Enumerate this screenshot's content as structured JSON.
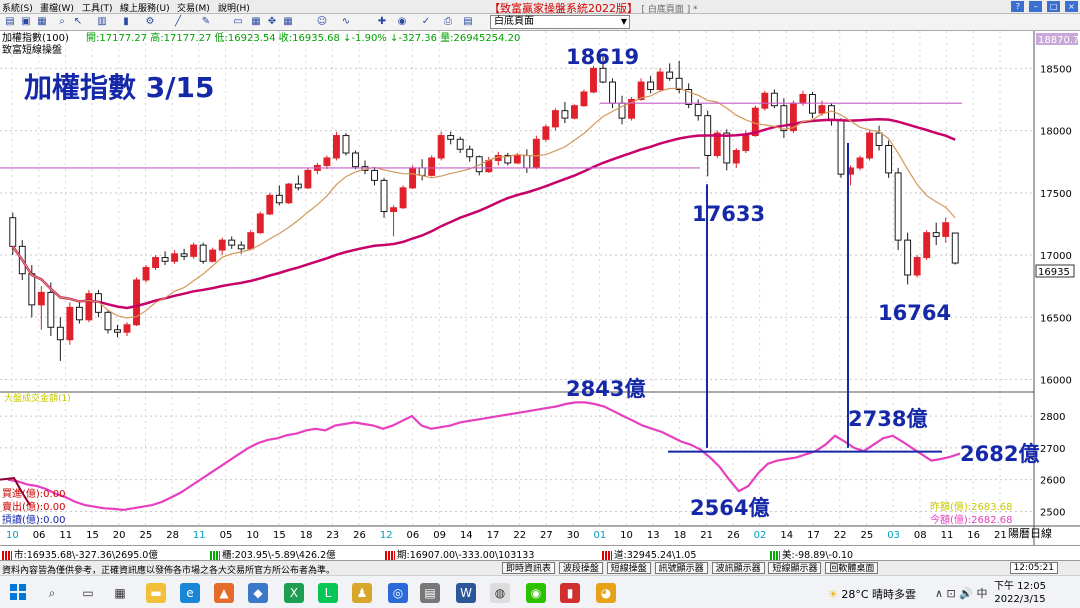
{
  "menu": {
    "items": [
      "系統(S)",
      "畫檔(W)",
      "工具(T)",
      "線上服務(U)",
      "交易(M)",
      "說明(H)"
    ],
    "title": "【致富贏家操盤系統2022版】",
    "title_sub": "[ 白底頁面 ] *",
    "window_buttons": [
      "?",
      "–",
      "□",
      "×"
    ]
  },
  "toolbar": {
    "page_select": "白底頁面",
    "icons": [
      "print-icon",
      "save-icon",
      "grid-icon",
      "zoom-icon",
      "chart-icon",
      "arrow-icon",
      "tools-icon"
    ]
  },
  "chart_header": {
    "line1": "加權指數(100)",
    "ohlc": "開:17177.27 高:17177.27 低:16923.54 收:16935.68 ↓-1.90% ↓-327.36  量:26945254.20",
    "line2": "致富短線操盤",
    "big_title": "加權指數 3/15",
    "last_price_tag": "16935",
    "top_value_tag": "18870.7"
  },
  "annotations": {
    "high": "18619",
    "low1": "17633",
    "low2": "16764",
    "vol_high": "2843億",
    "vol_low": "2564億",
    "vol_mid": "2738億",
    "vol_now": "2682億"
  },
  "volume_panel": {
    "title": "大盤成交金額(1)",
    "buy_label": "買進(億):0.00",
    "sell_label": "賣出(億):0.00",
    "hold_label": "摃讀(億):0.00",
    "right1": "昨額(億):2683.68",
    "right2": "今額(億):2682.68"
  },
  "axis": {
    "x_ticks": [
      "10",
      "06",
      "11",
      "15",
      "20",
      "25",
      "28",
      "11",
      "05",
      "10",
      "15",
      "18",
      "23",
      "26",
      "12",
      "06",
      "09",
      "14",
      "17",
      "22",
      "27",
      "30",
      "01",
      "10",
      "13",
      "18",
      "21",
      "26",
      "02",
      "14",
      "17",
      "22",
      "25",
      "03",
      "08",
      "11",
      "16",
      "21"
    ],
    "x_unit": "陽曆日線",
    "y_ticks": [
      "18500",
      "18000",
      "17500",
      "17000",
      "16500",
      "16000"
    ],
    "y2_ticks": [
      "2800",
      "2700",
      "2600",
      "2500"
    ]
  },
  "status_bar": {
    "seg1": "市:16935.68\\-327.36\\2695.0億",
    "seg2": "櫃:203.95\\-5.89\\426.2億",
    "seg3": "期:16907.00\\-333.00\\103133",
    "seg4": "道:32945.24\\1.05",
    "seg5": "美:-98.89\\-0.10"
  },
  "info_bar": {
    "disclaimer": "資料內容皆為僅供參考，正確資訊應以發佈各市場之各大交易所官方所公布者為準。",
    "buttons": [
      "即時資訊表",
      "波段操盤",
      "短線操盤",
      "訊號顯示器",
      "波訊顯示器",
      "短線顯示器",
      "回軟體桌面"
    ],
    "clock": "12:05:21"
  },
  "taskbar": {
    "weather": "28°C 晴時多雲",
    "tray": "∧ ⊡ 🔊 中",
    "time": "下午 12:05",
    "date": "2022/3/15"
  },
  "colors": {
    "up": "#e0202a",
    "down": "#1a1a1a",
    "ma_long": "#c8006a",
    "ma_short": "#d4975a",
    "volume_line": "#e63fbf",
    "annotation": "#1428a8",
    "hline": "#c85fc8"
  },
  "chart_data": {
    "type": "candlestick",
    "title": "加權指數 3/15",
    "ylim": [
      15900,
      18800
    ],
    "y2lim": [
      2470,
      2860
    ],
    "candles": [
      [
        17300,
        17340,
        17000,
        17070
      ],
      [
        17070,
        17120,
        16800,
        16850
      ],
      [
        16850,
        16920,
        16500,
        16600
      ],
      [
        16600,
        16750,
        16400,
        16700
      ],
      [
        16700,
        16780,
        16350,
        16420
      ],
      [
        16420,
        16500,
        16150,
        16320
      ],
      [
        16320,
        16620,
        16280,
        16580
      ],
      [
        16580,
        16630,
        16450,
        16480
      ],
      [
        16480,
        16720,
        16460,
        16690
      ],
      [
        16690,
        16720,
        16500,
        16540
      ],
      [
        16540,
        16560,
        16370,
        16400
      ],
      [
        16400,
        16440,
        16340,
        16380
      ],
      [
        16380,
        16460,
        16350,
        16440
      ],
      [
        16440,
        16820,
        16430,
        16800
      ],
      [
        16800,
        16920,
        16780,
        16900
      ],
      [
        16900,
        17000,
        16880,
        16980
      ],
      [
        16980,
        17030,
        16920,
        16950
      ],
      [
        16950,
        17040,
        16930,
        17010
      ],
      [
        17010,
        17050,
        16960,
        16990
      ],
      [
        16990,
        17100,
        16970,
        17080
      ],
      [
        17080,
        17100,
        16930,
        16950
      ],
      [
        16950,
        17060,
        16940,
        17040
      ],
      [
        17040,
        17140,
        17000,
        17120
      ],
      [
        17120,
        17150,
        17050,
        17080
      ],
      [
        17080,
        17110,
        17010,
        17050
      ],
      [
        17050,
        17200,
        17040,
        17180
      ],
      [
        17180,
        17350,
        17170,
        17330
      ],
      [
        17330,
        17500,
        17320,
        17480
      ],
      [
        17480,
        17560,
        17400,
        17420
      ],
      [
        17420,
        17580,
        17410,
        17570
      ],
      [
        17570,
        17640,
        17520,
        17540
      ],
      [
        17540,
        17700,
        17530,
        17680
      ],
      [
        17680,
        17740,
        17650,
        17720
      ],
      [
        17720,
        17800,
        17690,
        17780
      ],
      [
        17780,
        17990,
        17760,
        17960
      ],
      [
        17960,
        17980,
        17800,
        17820
      ],
      [
        17820,
        17840,
        17690,
        17710
      ],
      [
        17710,
        17760,
        17650,
        17680
      ],
      [
        17680,
        17700,
        17560,
        17600
      ],
      [
        17600,
        17620,
        17300,
        17350
      ],
      [
        17350,
        17400,
        17150,
        17380
      ],
      [
        17380,
        17560,
        17370,
        17540
      ],
      [
        17540,
        17720,
        17530,
        17700
      ],
      [
        17700,
        17770,
        17600,
        17640
      ],
      [
        17640,
        17800,
        17630,
        17780
      ],
      [
        17780,
        17990,
        17760,
        17960
      ],
      [
        17960,
        17990,
        17890,
        17930
      ],
      [
        17930,
        17950,
        17820,
        17850
      ],
      [
        17850,
        17880,
        17750,
        17790
      ],
      [
        17790,
        17800,
        17640,
        17670
      ],
      [
        17670,
        17790,
        17660,
        17760
      ],
      [
        17760,
        17830,
        17720,
        17800
      ],
      [
        17800,
        17820,
        17720,
        17740
      ],
      [
        17740,
        17820,
        17730,
        17800
      ],
      [
        17800,
        17850,
        17660,
        17700
      ],
      [
        17700,
        17960,
        17690,
        17930
      ],
      [
        17930,
        18050,
        17910,
        18030
      ],
      [
        18030,
        18180,
        18000,
        18160
      ],
      [
        18160,
        18230,
        18060,
        18100
      ],
      [
        18100,
        18210,
        18090,
        18200
      ],
      [
        18200,
        18330,
        18190,
        18310
      ],
      [
        18310,
        18520,
        18300,
        18500
      ],
      [
        18500,
        18619,
        18380,
        18390
      ],
      [
        18390,
        18420,
        18180,
        18220
      ],
      [
        18220,
        18280,
        18050,
        18100
      ],
      [
        18100,
        18270,
        18080,
        18250
      ],
      [
        18250,
        18420,
        18240,
        18390
      ],
      [
        18390,
        18440,
        18300,
        18330
      ],
      [
        18330,
        18500,
        18310,
        18470
      ],
      [
        18470,
        18540,
        18400,
        18420
      ],
      [
        18420,
        18560,
        18300,
        18330
      ],
      [
        18330,
        18380,
        18180,
        18210
      ],
      [
        18210,
        18250,
        18080,
        18120
      ],
      [
        18120,
        18160,
        17633,
        17800
      ],
      [
        17800,
        18000,
        17780,
        17980
      ],
      [
        17980,
        18010,
        17680,
        17740
      ],
      [
        17740,
        17860,
        17700,
        17840
      ],
      [
        17840,
        18000,
        17820,
        17960
      ],
      [
        17960,
        18200,
        17950,
        18180
      ],
      [
        18180,
        18320,
        18160,
        18300
      ],
      [
        18300,
        18330,
        18180,
        18200
      ],
      [
        18200,
        18260,
        17940,
        18000
      ],
      [
        18000,
        18240,
        17980,
        18220
      ],
      [
        18220,
        18320,
        18200,
        18290
      ],
      [
        18290,
        18310,
        18100,
        18140
      ],
      [
        18140,
        18240,
        18120,
        18200
      ],
      [
        18200,
        18220,
        18040,
        18080
      ],
      [
        18080,
        18100,
        17620,
        17650
      ],
      [
        17650,
        17720,
        17560,
        17700
      ],
      [
        17700,
        17800,
        17680,
        17780
      ],
      [
        17780,
        18000,
        17760,
        17980
      ],
      [
        17980,
        18040,
        17840,
        17880
      ],
      [
        17880,
        17920,
        17620,
        17660
      ],
      [
        17660,
        17700,
        17040,
        17120
      ],
      [
        17120,
        17180,
        16764,
        16840
      ],
      [
        16840,
        17000,
        16820,
        16980
      ],
      [
        16980,
        17200,
        16960,
        17180
      ],
      [
        17180,
        17260,
        17080,
        17150
      ],
      [
        17150,
        17300,
        17100,
        17260
      ],
      [
        17177,
        17177,
        16924,
        16936
      ]
    ],
    "volume": [
      2600,
      2595,
      2585,
      2580,
      2570,
      2555,
      2545,
      2530,
      2520,
      2515,
      2510,
      2508,
      2505,
      2510,
      2515,
      2520,
      2530,
      2545,
      2560,
      2580,
      2600,
      2620,
      2640,
      2660,
      2680,
      2700,
      2715,
      2725,
      2730,
      2740,
      2745,
      2755,
      2760,
      2755,
      2770,
      2775,
      2780,
      2775,
      2770,
      2760,
      2770,
      2785,
      2800,
      2770,
      2760,
      2765,
      2770,
      2780,
      2785,
      2790,
      2795,
      2800,
      2805,
      2810,
      2815,
      2820,
      2825,
      2830,
      2838,
      2843,
      2843,
      2838,
      2830,
      2815,
      2800,
      2785,
      2770,
      2760,
      2750,
      2735,
      2720,
      2710,
      2695,
      2670,
      2640,
      2600,
      2564,
      2580,
      2620,
      2650,
      2660,
      2665,
      2670,
      2680,
      2690,
      2710,
      2738,
      2720,
      2700,
      2690,
      2710,
      2730,
      2738,
      2720,
      2700,
      2680,
      2660,
      2665,
      2672,
      2682
    ],
    "annotations": [
      "18619",
      "17633",
      "16764",
      "2843億",
      "2564億",
      "2738億",
      "2682億"
    ]
  }
}
